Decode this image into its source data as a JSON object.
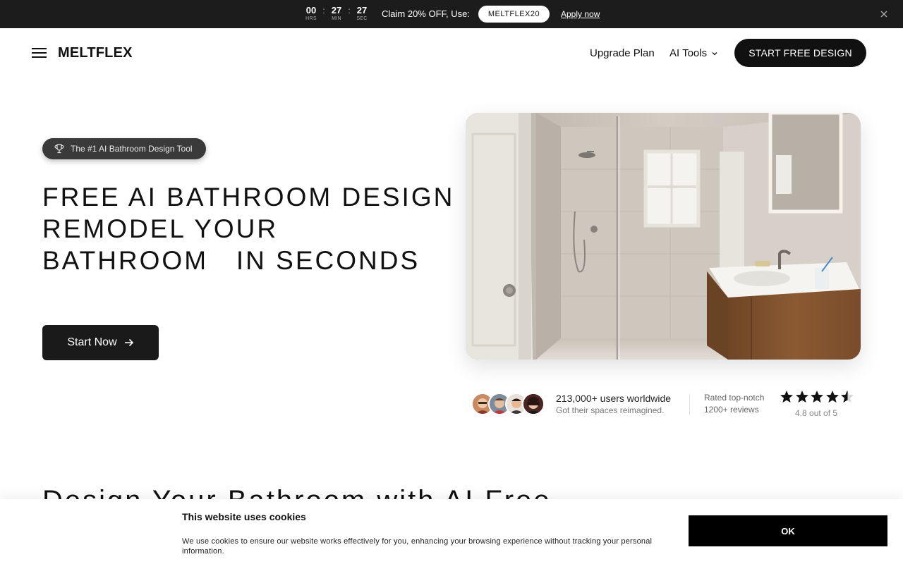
{
  "promo": {
    "timer": [
      {
        "value": "00",
        "label": "HRS"
      },
      {
        "value": "27",
        "label": "MIN"
      },
      {
        "value": "27",
        "label": "SEC"
      }
    ],
    "separator": ":",
    "claim_text": "Claim 20% OFF, Use:",
    "code": "MELTFLEX20",
    "apply_label": "Apply now",
    "close_icon": "close-icon"
  },
  "header": {
    "logo": "MELTFLEX",
    "menu_icon": "hamburger-icon",
    "nav": {
      "upgrade": "Upgrade Plan",
      "tools": "AI Tools",
      "tools_icon": "chevron-down-icon"
    },
    "cta": "START FREE DESIGN"
  },
  "hero": {
    "badge": "The #1 AI Bathroom Design Tool",
    "badge_icon": "trophy-icon",
    "title_lines": [
      "FREE AI BATHROOM DESIGN",
      "REMODEL YOUR",
      "BATHROOM   IN SECONDS"
    ],
    "start_label": "Start Now",
    "start_icon": "arrow-right-icon"
  },
  "social": {
    "users_main": "213,000+ users worldwide",
    "users_sub": "Got their spaces reimagined.",
    "rated_main": "Rated top-notch",
    "rated_sub": "1200+ reviews",
    "rating": 4.8,
    "score_text": "4.8 out of 5"
  },
  "section": {
    "title": "Design Your Bathroom with AI Free"
  },
  "cookie": {
    "title": "This website uses cookies",
    "text": "We use cookies to ensure our website works effectively for you, enhancing your browsing experience without tracking your personal information.",
    "ok_label": "OK"
  },
  "colors": {
    "dark": "#111111",
    "promo_bg": "#1c1c1c",
    "badge_bg": "#3a3a3a"
  }
}
